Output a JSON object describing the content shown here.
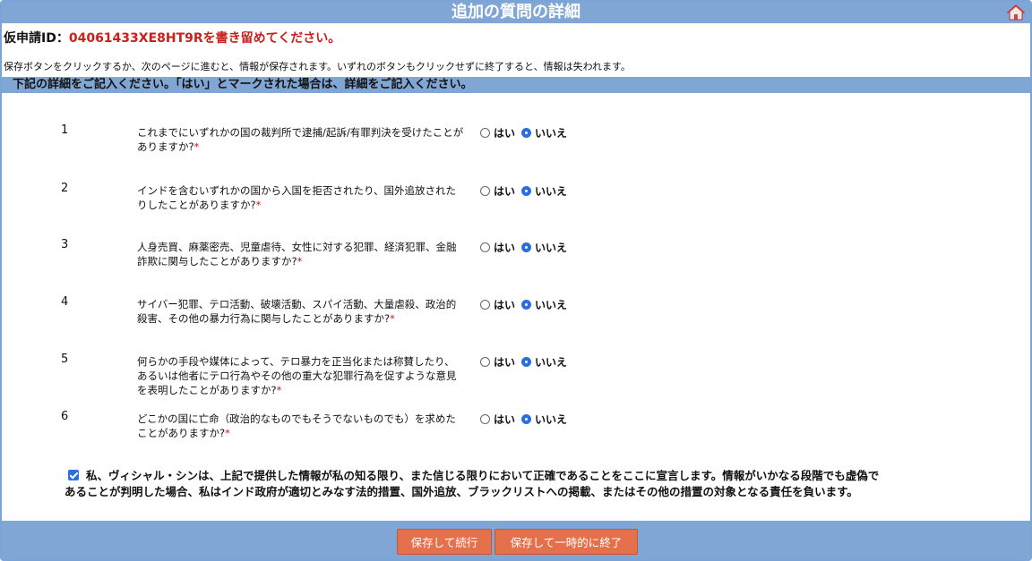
{
  "page": {
    "title": "追加の質問の詳細",
    "app_id_label": "仮申請ID：",
    "app_id_value": "04061433XE8HT9Rを書き留めてください。",
    "info_text": "保存ボタンをクリックするか、次のページに進むと、情報が保存されます。いずれのボタンもクリックせずに終了すると、情報は失われます。",
    "section_header": "下記の詳細をご記入ください。「はい」とマークされた場合は、詳細をご記入ください。"
  },
  "questions": [
    {
      "num": "1",
      "text": "これまでにいずれかの国の裁判所で逮捕/起訴/有罪判決を受けたことがありますか?",
      "required": "*",
      "yes_label": "はい",
      "no_label": "いいえ",
      "selected": "いいえ"
    },
    {
      "num": "2",
      "text": "インドを含むいずれかの国から入国を拒否されたり、国外追放されたりしたことがありますか?",
      "required": "*",
      "yes_label": "はい",
      "no_label": "いいえ",
      "selected": "いいえ"
    },
    {
      "num": "3",
      "text": "人身売買、麻薬密売、児童虐待、女性に対する犯罪、経済犯罪、金融詐欺に関与したことがありますか?",
      "required": "*",
      "yes_label": "はい",
      "no_label": "いいえ",
      "selected": "いいえ"
    },
    {
      "num": "4",
      "text": "サイバー犯罪、テロ活動、破壊活動、スパイ活動、大量虐殺、政治的殺害、その他の暴力行為に関与したことがありますか?",
      "required": "*",
      "yes_label": "はい",
      "no_label": "いいえ",
      "selected": "いいえ"
    },
    {
      "num": "5",
      "text": "何らかの手段や媒体によって、テロ暴力を正当化または称賛したり、あるいは他者にテロ行為やその他の重大な犯罪行為を促すような意見を表明したことがありますか?",
      "required": "*",
      "yes_label": "はい",
      "no_label": "いいえ",
      "selected": "いいえ"
    },
    {
      "num": "6",
      "text": "どこかの国に亡命（政治的なものでもそうでないものでも）を求めたことがありますか?",
      "required": "*",
      "yes_label": "はい",
      "no_label": "いいえ",
      "selected": "いいえ"
    }
  ],
  "declaration": {
    "checked": true,
    "text": "私、ヴィシャル・シンは、上記で提供した情報が私の知る限り、また信じる限りにおいて正確であることをここに宣言します。情報がいかなる段階でも虚偽であることが判明した場合、私はインド政府が適切とみなす法的措置、国外追放、ブラックリストへの掲載、またはその他の措置の対象となる責任を負います。"
  },
  "buttons": {
    "save_continue": "保存して続行",
    "save_exit": "保存して一時的に終了"
  },
  "colors": {
    "header_bg": "#7fa6d4",
    "id_red": "#c8201c",
    "button_bg": "#e4704c",
    "radio_blue": "#2a6ee0"
  }
}
